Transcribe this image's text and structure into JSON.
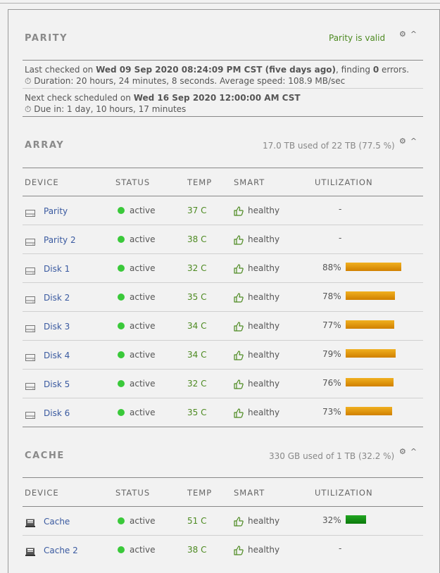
{
  "parity": {
    "title": "PARITY",
    "status": "Parity is valid",
    "last_checked_prefix": "Last checked on ",
    "last_checked_date": "Wed 09 Sep 2020 08:24:09 PM CST (five days ago)",
    "last_checked_mid": ", finding ",
    "errors_count": "0",
    "last_checked_suffix": " errors.",
    "duration_text": "Duration: 20 hours, 24 minutes, 8 seconds. Average speed: 108.9 MB/sec",
    "next_check_prefix": "Next check scheduled on ",
    "next_check_date": "Wed 16 Sep 2020 12:00:00 AM CST",
    "due_text": "Due in: 1 day, 10 hours, 17 minutes"
  },
  "array": {
    "title": "ARRAY",
    "summary": "17.0 TB used of 22 TB (77.5 %)"
  },
  "cache": {
    "title": "CACHE",
    "summary": "330 GB used of 1 TB (32.2 %)"
  },
  "columns": {
    "device": "DEVICE",
    "status": "STATUS",
    "temp": "TEMP",
    "smart": "SMART",
    "utilization": "UTILIZATION"
  },
  "array_rows": [
    {
      "name": "Parity",
      "status": "active",
      "temp": "37 C",
      "smart": "healthy",
      "util": "-",
      "util_pct": null
    },
    {
      "name": "Parity 2",
      "status": "active",
      "temp": "38 C",
      "smart": "healthy",
      "util": "-",
      "util_pct": null
    },
    {
      "name": "Disk 1",
      "status": "active",
      "temp": "32 C",
      "smart": "healthy",
      "util": "88%",
      "util_pct": 88
    },
    {
      "name": "Disk 2",
      "status": "active",
      "temp": "35 C",
      "smart": "healthy",
      "util": "78%",
      "util_pct": 78
    },
    {
      "name": "Disk 3",
      "status": "active",
      "temp": "34 C",
      "smart": "healthy",
      "util": "77%",
      "util_pct": 77
    },
    {
      "name": "Disk 4",
      "status": "active",
      "temp": "34 C",
      "smart": "healthy",
      "util": "79%",
      "util_pct": 79
    },
    {
      "name": "Disk 5",
      "status": "active",
      "temp": "32 C",
      "smart": "healthy",
      "util": "76%",
      "util_pct": 76
    },
    {
      "name": "Disk 6",
      "status": "active",
      "temp": "35 C",
      "smart": "healthy",
      "util": "73%",
      "util_pct": 73
    }
  ],
  "cache_rows": [
    {
      "name": "Cache",
      "status": "active",
      "temp": "51 C",
      "smart": "healthy",
      "util": "32%",
      "util_pct": 32
    },
    {
      "name": "Cache 2",
      "status": "active",
      "temp": "38 C",
      "smart": "healthy",
      "util": "-",
      "util_pct": null
    }
  ],
  "colors": {
    "status_active": "#3ac93a",
    "temp_text": "#4d8a21",
    "link": "#3a5aa0",
    "bar_orange": "#e0a010",
    "bar_green": "#119011"
  },
  "icons": {
    "settings": "gear-icon",
    "collapse": "chevron-up-icon",
    "hdd": "hard-drive-icon",
    "ssd": "ssd-icon",
    "smart": "thumbs-up-icon",
    "clock": "clock-icon"
  }
}
